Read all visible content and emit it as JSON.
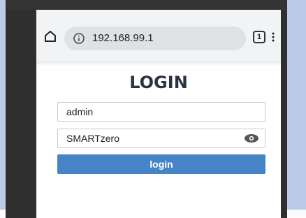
{
  "browser": {
    "url": "192.168.99.1",
    "tab_count": "1",
    "icons": [
      "home-icon",
      "info-icon",
      "tabs-icon",
      "menu-icon"
    ]
  },
  "login": {
    "title": "LOGIN",
    "username_value": "admin",
    "password_value": "SMARTzero",
    "button_label": "login",
    "accent_color": "#4684c6"
  }
}
